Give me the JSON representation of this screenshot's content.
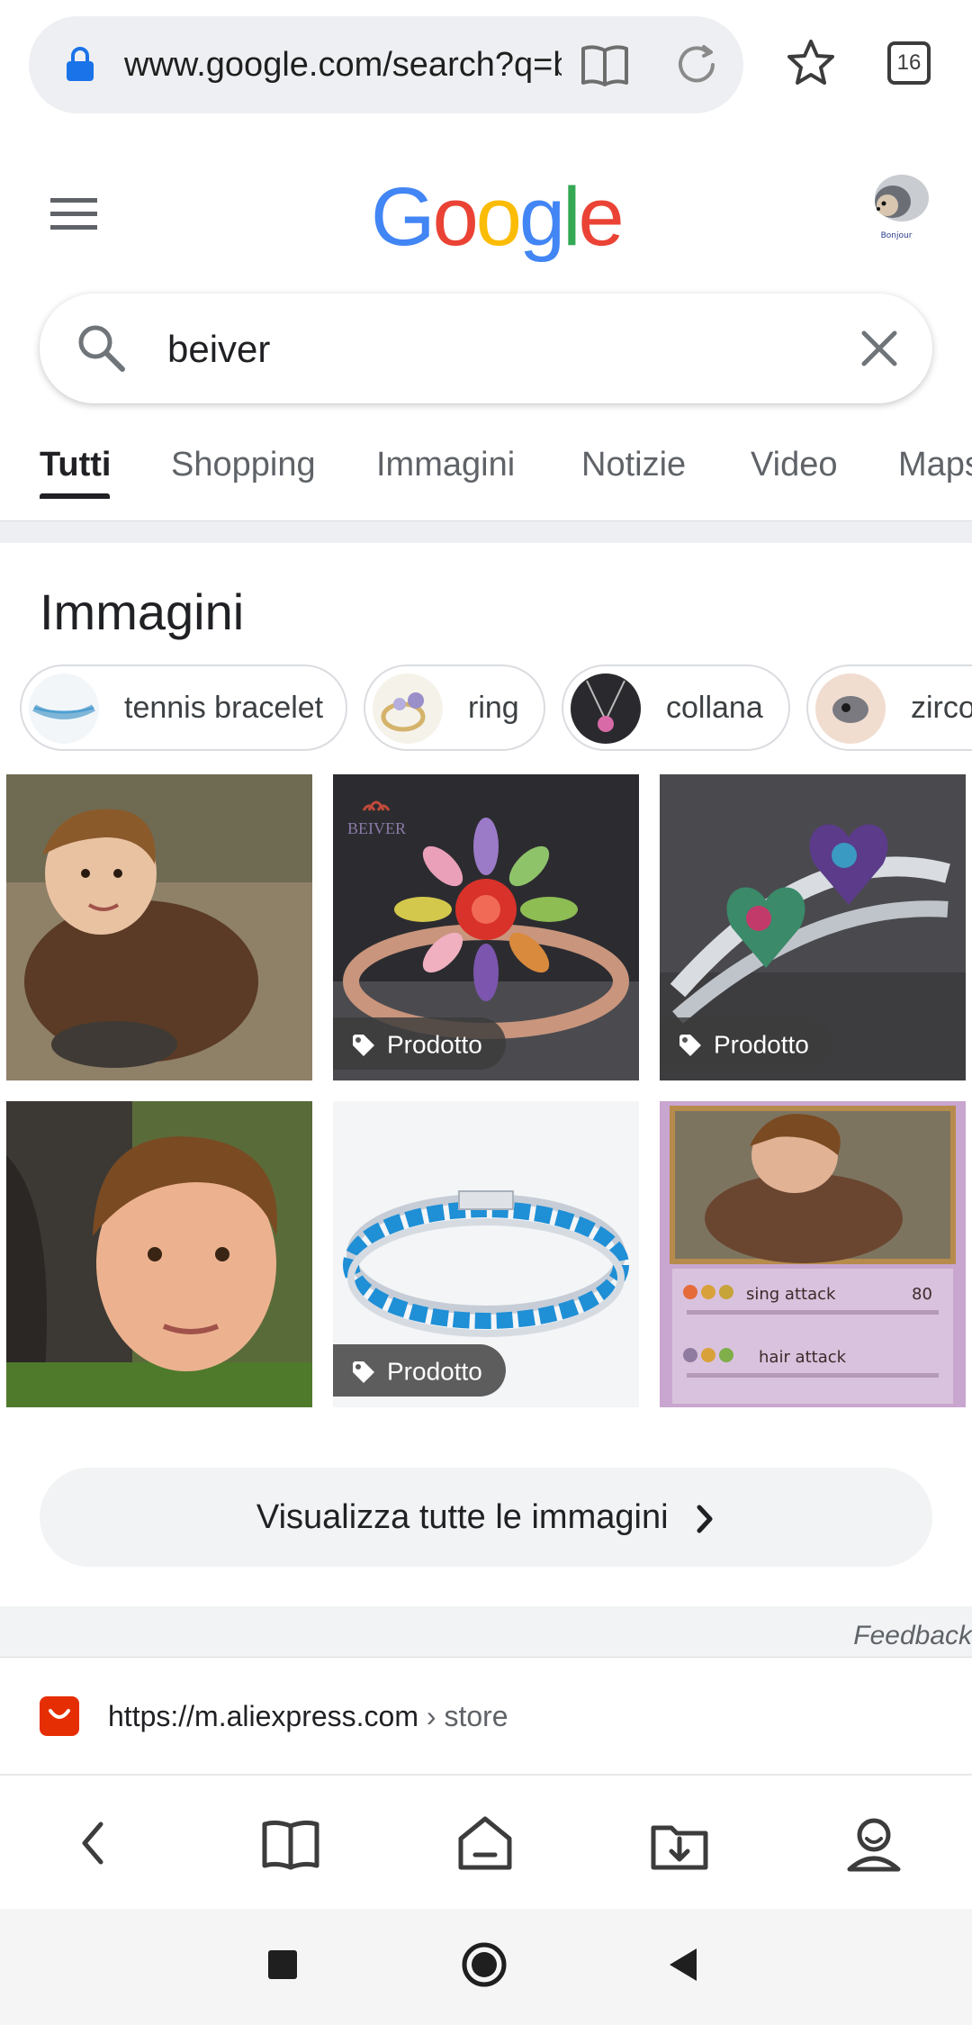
{
  "browser": {
    "url": "www.google.com/search?q=beiver",
    "tab_count": "16"
  },
  "google": {
    "logo_letters": [
      {
        "ch": "G",
        "color": "#4285F4"
      },
      {
        "ch": "o",
        "color": "#EA4335"
      },
      {
        "ch": "o",
        "color": "#FBBC05"
      },
      {
        "ch": "g",
        "color": "#4285F4"
      },
      {
        "ch": "l",
        "color": "#34A853"
      },
      {
        "ch": "e",
        "color": "#EA4335"
      }
    ],
    "avatar_caption": "Bonjour"
  },
  "search": {
    "query": "beiver"
  },
  "tabs": [
    "Tutti",
    "Shopping",
    "Immagini",
    "Notizie",
    "Video",
    "Maps"
  ],
  "images_section": {
    "title": "Immagini",
    "chips": [
      "tennis bracelet",
      "ring",
      "collana",
      "zirconi"
    ],
    "badge_label": "Prodotto",
    "view_all_label": "Visualizza tutte le immagini",
    "card_text": {
      "brand": "BEIVER",
      "attack1": "sing attack",
      "attack1_damage": "80",
      "attack2": "hair attack"
    }
  },
  "feedback_label": "Feedback",
  "result": {
    "url": "https://m.aliexpress.com",
    "crumb": " › store"
  },
  "colors": {
    "accent_blue": "#1a73e8",
    "aliexpress_red": "#e62e04"
  }
}
